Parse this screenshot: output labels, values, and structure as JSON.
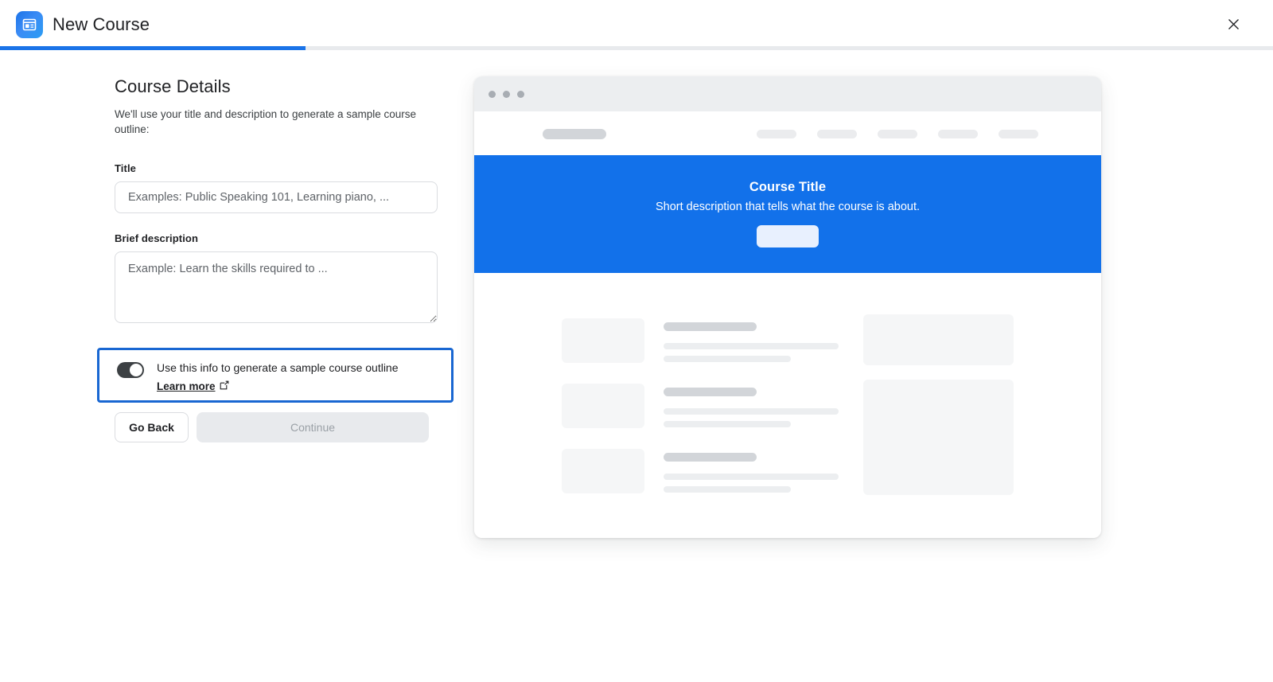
{
  "header": {
    "app_title": "New Course",
    "app_icon": "sites-page-icon",
    "close_icon": "close-icon"
  },
  "progress": {
    "percent": 24,
    "fill_color": "#1a73e8",
    "track_color": "#e8eaed"
  },
  "form": {
    "heading": "Course Details",
    "subtext": "We'll use your title and description to generate a sample course outline:",
    "title_field": {
      "label": "Title",
      "value": "",
      "placeholder": "Examples: Public Speaking 101, Learning piano, ..."
    },
    "description_field": {
      "label": "Brief description",
      "value": "",
      "placeholder": "Example: Learn the skills required to ..."
    },
    "toggle": {
      "label": "Use this info to generate a sample course outline",
      "state": "on",
      "link_label": "Learn more",
      "link_icon": "external-link-icon",
      "focus_ring_color": "#1967d2"
    },
    "buttons": {
      "back_label": "Go Back",
      "continue_label": "Continue",
      "continue_disabled": true
    }
  },
  "preview": {
    "window_dots": 3,
    "nav": {
      "logo_placeholder": "",
      "link_placeholders": [
        "",
        "",
        "",
        "",
        ""
      ]
    },
    "hero": {
      "title": "Course Title",
      "description": "Short description that tells what the course is about.",
      "button_placeholder": "",
      "background_color": "#1271ea"
    },
    "content_rows": [
      {
        "thumb": "",
        "heading": "",
        "line1": "",
        "line2": ""
      },
      {
        "thumb": "",
        "heading": "",
        "line1": "",
        "line2": ""
      },
      {
        "thumb": "",
        "heading": "",
        "line1": "",
        "line2": ""
      }
    ],
    "side_blocks": [
      "",
      ""
    ]
  }
}
